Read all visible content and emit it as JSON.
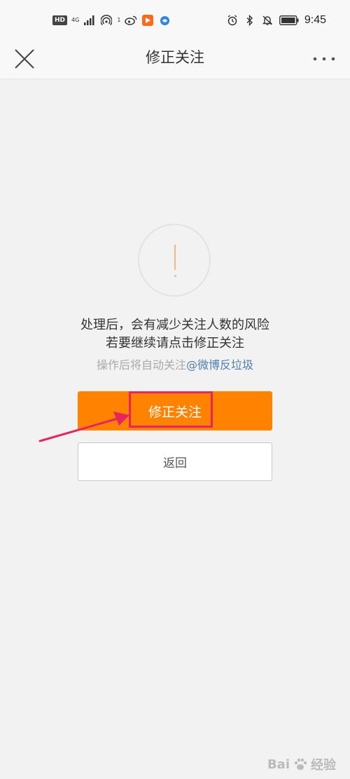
{
  "status_bar": {
    "hd_badge": "HD",
    "network": "4G",
    "hotspot_count": "1",
    "time": "9:45"
  },
  "nav": {
    "title": "修正关注"
  },
  "content": {
    "message_line1": "处理后，会有减少关注人数的风险",
    "message_line2": "若要继续请点击修正关注",
    "hint_prefix": "操作后将自动关注",
    "hint_link": "@微博反垃圾"
  },
  "buttons": {
    "primary_label": "修正关注",
    "secondary_label": "返回"
  },
  "watermark": {
    "brand": "Bai",
    "suffix": "经验"
  },
  "colors": {
    "primary": "#ff8200",
    "highlight": "#e8245e",
    "link": "#507daf",
    "warning": "#f7b48a"
  }
}
